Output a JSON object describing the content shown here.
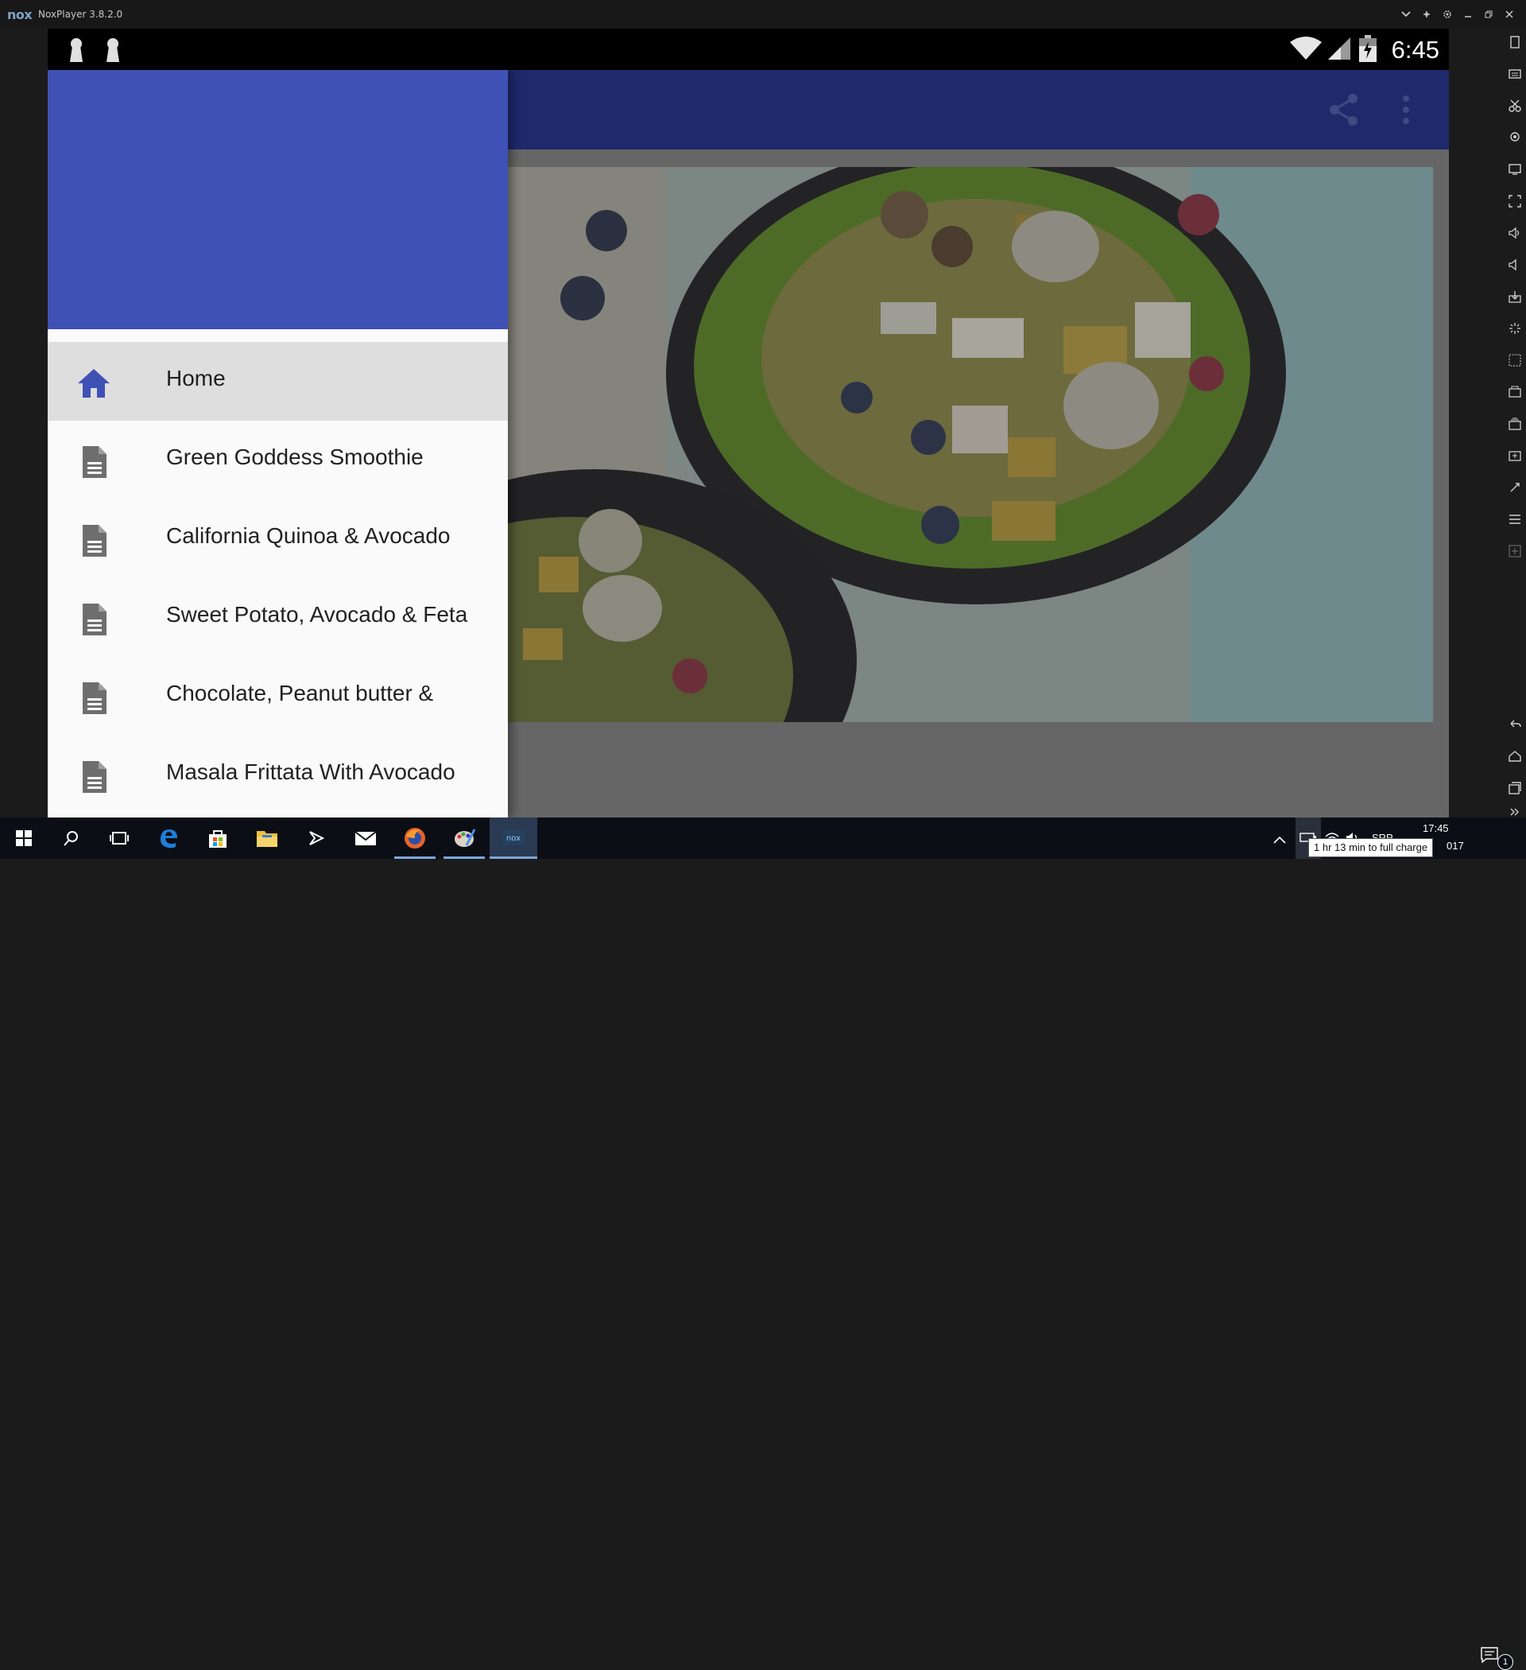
{
  "window": {
    "logo": "nox",
    "title": "NoxPlayer 3.8.2.0",
    "controls": [
      "chevron-down-icon",
      "pin-icon",
      "gear-icon",
      "minimize-icon",
      "restore-icon",
      "close-icon"
    ]
  },
  "status_bar": {
    "time": "6:45",
    "left_icons": [
      "keyhole-icon",
      "keyhole-icon"
    ],
    "right_icons": [
      "wifi-icon",
      "signal-icon",
      "battery-icon"
    ]
  },
  "app_bar": {
    "actions": [
      "share-icon",
      "more-vert-icon"
    ],
    "color": "#1e2a6b"
  },
  "drawer": {
    "header_color": "#3f51b5",
    "items": [
      {
        "label": "Home",
        "icon": "home-icon",
        "active": true
      },
      {
        "label": "Green Goddess Smoothie",
        "icon": "document-icon",
        "active": false
      },
      {
        "label": "California Quinoa & Avocado",
        "icon": "document-icon",
        "active": false
      },
      {
        "label": "Sweet Potato, Avocado & Feta",
        "icon": "document-icon",
        "active": false
      },
      {
        "label": "Chocolate, Peanut butter &",
        "icon": "document-icon",
        "active": false
      },
      {
        "label": "Masala Frittata With Avocado",
        "icon": "document-icon",
        "active": false
      }
    ]
  },
  "content": {
    "image": "smoothie-bowl-photo"
  },
  "taskbar": {
    "apps": [
      "windows-start-icon",
      "search-icon",
      "task-view-icon",
      "edge-icon",
      "store-icon",
      "file-explorer-icon",
      "visual-studio-icon",
      "mail-icon",
      "firefox-icon",
      "paint-icon",
      "nox-icon"
    ],
    "tray_time": "17:45",
    "tray_date_fragment": "017",
    "tray_lang": "SRP",
    "battery_tooltip": "1 hr 13 min to full charge",
    "notification_count": "1"
  }
}
